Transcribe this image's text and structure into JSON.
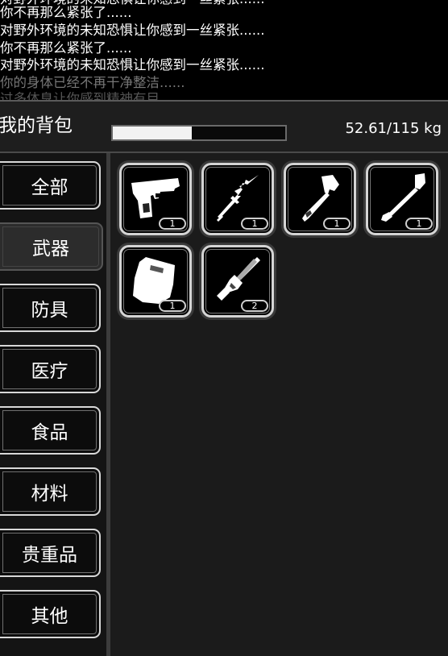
{
  "log": {
    "lines": [
      "你不再那么紧张了......",
      "对野外环境的未知恐惧让你感到一丝紧张......",
      "你不再那么紧张了......",
      "对野外环境的未知恐惧让你感到一丝紧张......",
      "你的身体已经不再干净整洁......"
    ]
  },
  "header": {
    "title": "我的背包",
    "weight_text": "52.61/115 kg",
    "weight_fraction": 0.4575
  },
  "categories": [
    {
      "label": "全部",
      "icon": "all"
    },
    {
      "label": "武器",
      "icon": "weapons",
      "active": true
    },
    {
      "label": "防具",
      "icon": "armor"
    },
    {
      "label": "医疗",
      "icon": "medical"
    },
    {
      "label": "食品",
      "icon": "food"
    },
    {
      "label": "材料",
      "icon": "materials"
    },
    {
      "label": "贵重品",
      "icon": "valuables"
    },
    {
      "label": "其他",
      "icon": "other"
    }
  ],
  "items": [
    {
      "icon": "pistol-icon",
      "count": "1"
    },
    {
      "icon": "spear-icon",
      "count": "1"
    },
    {
      "icon": "axe-icon",
      "count": "1"
    },
    {
      "icon": "shovel-icon",
      "count": "1"
    },
    {
      "icon": "riot-shield-icon",
      "count": "1"
    },
    {
      "icon": "minigun-icon",
      "count": "2"
    }
  ],
  "colors": {
    "accent": "#d4d4d4",
    "panel_bg": "#1b1b1b",
    "sidebar_bg": "#141414"
  }
}
